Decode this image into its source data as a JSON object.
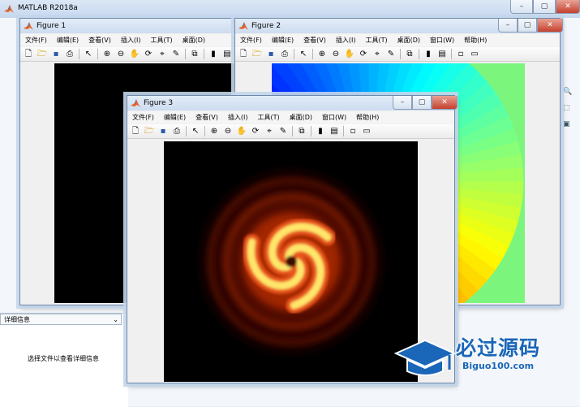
{
  "app": {
    "title": "MATLAB R2018a"
  },
  "window_buttons": {
    "minimize": "–",
    "maximize": "▢",
    "close": "✕"
  },
  "side_panel": {
    "details_header": "详细信息",
    "details_placeholder": "选择文件以查看详细信息"
  },
  "figure_menu": [
    "文件(F)",
    "编辑(E)",
    "查看(V)",
    "插入(I)",
    "工具(T)",
    "桌面(D)",
    "窗口(W)",
    "帮助(H)"
  ],
  "figures": [
    {
      "title": "Figure 1",
      "plot": "dark spiral intensity (hidden behind Figure 3)"
    },
    {
      "title": "Figure 2",
      "plot": "radial color wheel (jet colormap) on green background"
    },
    {
      "title": "Figure 3",
      "plot": "spiral vortex intensity map (hot colormap)"
    }
  ],
  "toolbar_icons": [
    "new-figure-icon",
    "open-file-icon",
    "save-icon",
    "print-icon",
    "select-arrow-icon",
    "zoom-in-icon",
    "zoom-out-icon",
    "pan-hand-icon",
    "rotate-3d-icon",
    "data-cursor-icon",
    "brush-icon",
    "link-plot-icon",
    "colorbar-icon",
    "legend-icon",
    "hide-tools-icon",
    "show-tools-icon"
  ],
  "watermark": {
    "text": "必过源码",
    "url": "Biguo100.com"
  },
  "colors": {
    "accent": "#1a66b8",
    "fig2_background": "#7cf57c",
    "close_button": "#c4402d"
  }
}
